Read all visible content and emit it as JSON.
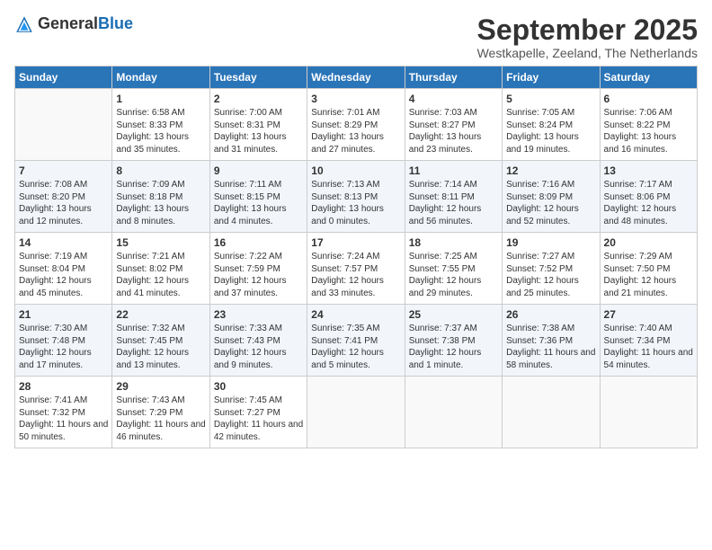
{
  "header": {
    "logo_general": "General",
    "logo_blue": "Blue",
    "month": "September 2025",
    "location": "Westkapelle, Zeeland, The Netherlands"
  },
  "weekdays": [
    "Sunday",
    "Monday",
    "Tuesday",
    "Wednesday",
    "Thursday",
    "Friday",
    "Saturday"
  ],
  "weeks": [
    [
      {
        "day": null
      },
      {
        "day": 1,
        "sunrise": "6:58 AM",
        "sunset": "8:33 PM",
        "daylight": "13 hours and 35 minutes."
      },
      {
        "day": 2,
        "sunrise": "7:00 AM",
        "sunset": "8:31 PM",
        "daylight": "13 hours and 31 minutes."
      },
      {
        "day": 3,
        "sunrise": "7:01 AM",
        "sunset": "8:29 PM",
        "daylight": "13 hours and 27 minutes."
      },
      {
        "day": 4,
        "sunrise": "7:03 AM",
        "sunset": "8:27 PM",
        "daylight": "13 hours and 23 minutes."
      },
      {
        "day": 5,
        "sunrise": "7:05 AM",
        "sunset": "8:24 PM",
        "daylight": "13 hours and 19 minutes."
      },
      {
        "day": 6,
        "sunrise": "7:06 AM",
        "sunset": "8:22 PM",
        "daylight": "13 hours and 16 minutes."
      }
    ],
    [
      {
        "day": 7,
        "sunrise": "7:08 AM",
        "sunset": "8:20 PM",
        "daylight": "13 hours and 12 minutes."
      },
      {
        "day": 8,
        "sunrise": "7:09 AM",
        "sunset": "8:18 PM",
        "daylight": "13 hours and 8 minutes."
      },
      {
        "day": 9,
        "sunrise": "7:11 AM",
        "sunset": "8:15 PM",
        "daylight": "13 hours and 4 minutes."
      },
      {
        "day": 10,
        "sunrise": "7:13 AM",
        "sunset": "8:13 PM",
        "daylight": "13 hours and 0 minutes."
      },
      {
        "day": 11,
        "sunrise": "7:14 AM",
        "sunset": "8:11 PM",
        "daylight": "12 hours and 56 minutes."
      },
      {
        "day": 12,
        "sunrise": "7:16 AM",
        "sunset": "8:09 PM",
        "daylight": "12 hours and 52 minutes."
      },
      {
        "day": 13,
        "sunrise": "7:17 AM",
        "sunset": "8:06 PM",
        "daylight": "12 hours and 48 minutes."
      }
    ],
    [
      {
        "day": 14,
        "sunrise": "7:19 AM",
        "sunset": "8:04 PM",
        "daylight": "12 hours and 45 minutes."
      },
      {
        "day": 15,
        "sunrise": "7:21 AM",
        "sunset": "8:02 PM",
        "daylight": "12 hours and 41 minutes."
      },
      {
        "day": 16,
        "sunrise": "7:22 AM",
        "sunset": "7:59 PM",
        "daylight": "12 hours and 37 minutes."
      },
      {
        "day": 17,
        "sunrise": "7:24 AM",
        "sunset": "7:57 PM",
        "daylight": "12 hours and 33 minutes."
      },
      {
        "day": 18,
        "sunrise": "7:25 AM",
        "sunset": "7:55 PM",
        "daylight": "12 hours and 29 minutes."
      },
      {
        "day": 19,
        "sunrise": "7:27 AM",
        "sunset": "7:52 PM",
        "daylight": "12 hours and 25 minutes."
      },
      {
        "day": 20,
        "sunrise": "7:29 AM",
        "sunset": "7:50 PM",
        "daylight": "12 hours and 21 minutes."
      }
    ],
    [
      {
        "day": 21,
        "sunrise": "7:30 AM",
        "sunset": "7:48 PM",
        "daylight": "12 hours and 17 minutes."
      },
      {
        "day": 22,
        "sunrise": "7:32 AM",
        "sunset": "7:45 PM",
        "daylight": "12 hours and 13 minutes."
      },
      {
        "day": 23,
        "sunrise": "7:33 AM",
        "sunset": "7:43 PM",
        "daylight": "12 hours and 9 minutes."
      },
      {
        "day": 24,
        "sunrise": "7:35 AM",
        "sunset": "7:41 PM",
        "daylight": "12 hours and 5 minutes."
      },
      {
        "day": 25,
        "sunrise": "7:37 AM",
        "sunset": "7:38 PM",
        "daylight": "12 hours and 1 minute."
      },
      {
        "day": 26,
        "sunrise": "7:38 AM",
        "sunset": "7:36 PM",
        "daylight": "11 hours and 58 minutes."
      },
      {
        "day": 27,
        "sunrise": "7:40 AM",
        "sunset": "7:34 PM",
        "daylight": "11 hours and 54 minutes."
      }
    ],
    [
      {
        "day": 28,
        "sunrise": "7:41 AM",
        "sunset": "7:32 PM",
        "daylight": "11 hours and 50 minutes."
      },
      {
        "day": 29,
        "sunrise": "7:43 AM",
        "sunset": "7:29 PM",
        "daylight": "11 hours and 46 minutes."
      },
      {
        "day": 30,
        "sunrise": "7:45 AM",
        "sunset": "7:27 PM",
        "daylight": "11 hours and 42 minutes."
      },
      {
        "day": null
      },
      {
        "day": null
      },
      {
        "day": null
      },
      {
        "day": null
      }
    ]
  ]
}
